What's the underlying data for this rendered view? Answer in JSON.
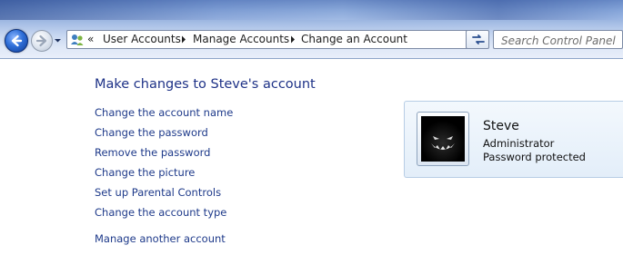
{
  "nav": {
    "breadcrumb": [
      "User Accounts",
      "Manage Accounts",
      "Change an Account"
    ],
    "overflow": "«",
    "search_placeholder": "Search Control Panel"
  },
  "main": {
    "title": "Make changes to Steve's account",
    "tasks": [
      "Change the account name",
      "Change the password",
      "Remove the password",
      "Change the picture",
      "Set up Parental Controls",
      "Change the account type"
    ],
    "manage_other": "Manage another account"
  },
  "account": {
    "name": "Steve",
    "role": "Administrator",
    "password_status": "Password protected"
  },
  "colors": {
    "link": "#1e3a8a",
    "title": "#1e3287"
  }
}
